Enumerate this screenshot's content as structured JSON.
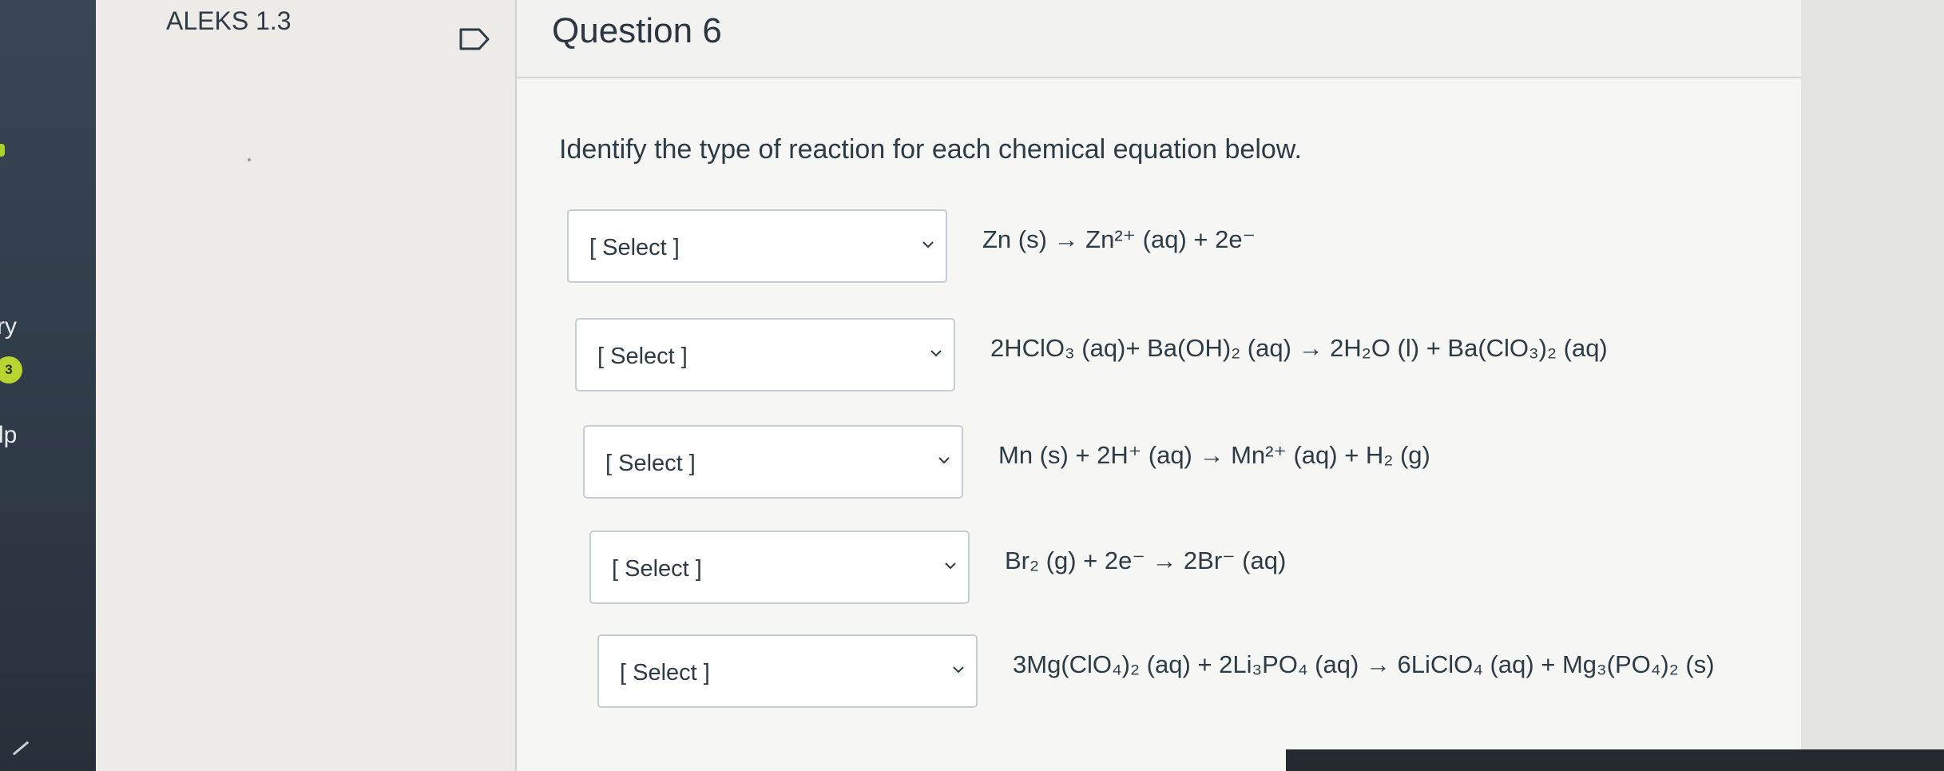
{
  "app": {
    "title": "ALEKS 1.3"
  },
  "sidebar": {
    "fragment_1": "ry",
    "badge": "3",
    "fragment_2": "lp"
  },
  "question": {
    "title": "Question 6",
    "instructions": "Identify the type of reaction for each chemical equation below."
  },
  "rows": [
    {
      "select": "[ Select ]",
      "equation": "Zn (s) → Zn²⁺ (aq) + 2e⁻"
    },
    {
      "select": "[ Select ]",
      "equation": "2HClO₃ (aq)+ Ba(OH)₂ (aq) → 2H₂O (l) + Ba(ClO₃)₂ (aq)"
    },
    {
      "select": "[ Select ]",
      "equation": "Mn (s) + 2H⁺ (aq) → Mn²⁺ (aq) + H₂ (g)"
    },
    {
      "select": "[ Select ]",
      "equation": "Br₂ (g) + 2e⁻ → 2Br⁻ (aq)"
    },
    {
      "select": "[ Select ]",
      "equation": "3Mg(ClO₄)₂ (aq) + 2Li₃PO₄ (aq) → 6LiClO₄ (aq) + Mg₃(PO₄)₂ (s)"
    }
  ],
  "icons": {
    "flag": "flag-icon",
    "dropdown": "chevron-down-icon"
  },
  "colors": {
    "badge": "#b7d431",
    "sidebar": "#2f3a47",
    "text": "#2d3b45"
  }
}
